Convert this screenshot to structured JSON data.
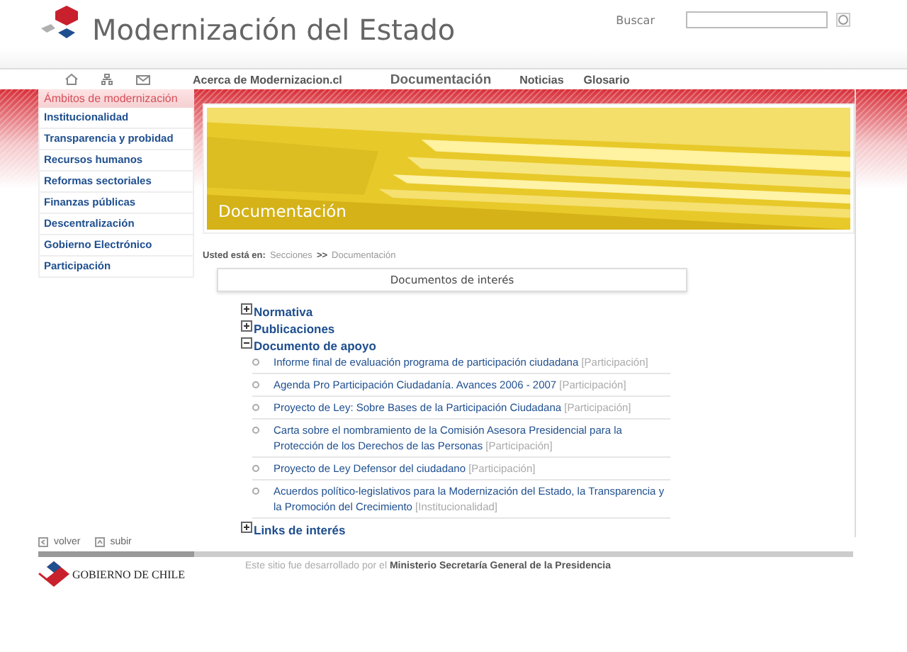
{
  "header": {
    "title": "Modernización del Estado",
    "search": {
      "label": "Buscar"
    }
  },
  "nav": {
    "links": [
      {
        "label": "Acerca de Modernizacion.cl",
        "selected": false
      },
      {
        "label": "Documentación",
        "selected": true
      },
      {
        "label": "Noticias",
        "selected": false
      },
      {
        "label": "Glosario",
        "selected": false
      }
    ]
  },
  "sidebar": {
    "title": "Ámbitos de modernización",
    "items": [
      "Institucionalidad",
      "Transparencia y probidad",
      "Recursos humanos",
      "Reformas sectoriales",
      "Finanzas públicas",
      "Descentralización",
      "Gobierno Electrónico",
      "Participación"
    ]
  },
  "banner": {
    "title": "Documentación"
  },
  "breadcrumb": {
    "label": "Usted está en:",
    "path": [
      "Secciones",
      ">>",
      "Documentación"
    ]
  },
  "documents": {
    "title": "Documentos de interés",
    "sections": [
      {
        "label": "Normativa",
        "expanded": false
      },
      {
        "label": "Publicaciones",
        "expanded": false
      },
      {
        "label": "Documento de apoyo",
        "expanded": true,
        "children": [
          {
            "title": "Informe final de evaluación programa de participación ciudadana",
            "tag": "[Participación]"
          },
          {
            "title": "Agenda Pro Participación Ciudadanía. Avances 2006 - 2007",
            "tag": "[Participación]"
          },
          {
            "title": "Proyecto de Ley: Sobre Bases de la Participación Ciudadana",
            "tag": "[Participación]"
          },
          {
            "title": "Carta sobre el nombramiento de la Comisión Asesora Presidencial para la Protección de los Derechos de las Personas",
            "tag": "[Participación]"
          },
          {
            "title": "Proyecto de Ley Defensor del ciudadano",
            "tag": "[Participación]"
          },
          {
            "title": "Acuerdos político-legislativos para la Modernización del Estado, la Transparencia y la Promoción del Crecimiento",
            "tag": "[Institucionalidad]"
          }
        ]
      },
      {
        "label": "Links de interés",
        "expanded": false
      }
    ]
  },
  "footer": {
    "links": [
      {
        "label": "volver",
        "kind": "back"
      },
      {
        "label": "subir",
        "kind": "up"
      }
    ],
    "logo": "GOBIERNO DE CHILE",
    "credit": "Este sitio fue desarrollado por el **Ministerio Secretaría General de la Presidencia**"
  }
}
